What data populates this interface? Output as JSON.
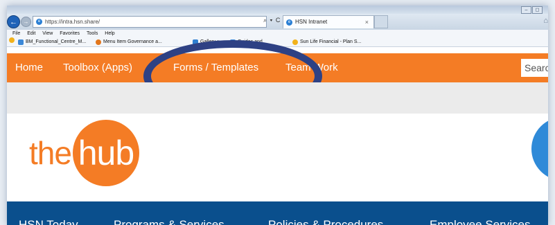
{
  "browser": {
    "window_buttons": [
      "–",
      "◻"
    ],
    "url": "https://intra.hsn.share/",
    "url_tools": "⌕ ▾ C",
    "tab_title": "HSN Intranet",
    "tab_close": "×",
    "menu": [
      "File",
      "Edit",
      "View",
      "Favorites",
      "Tools",
      "Help"
    ],
    "favorites": [
      {
        "label": "BM_Functional_Centre_M...",
        "icon": "ie-page-icon",
        "color": "#3b88d8"
      },
      {
        "label": "Menu Item Governance a...",
        "icon": "gear-icon",
        "color": "#e2761c"
      },
      {
        "label": "Gallery ▾",
        "icon": "web-slice-icon",
        "color": "#2e7fd1"
      },
      {
        "label": "Guides and",
        "icon": "ie-page-icon",
        "color": "#3b88d8"
      },
      {
        "label": "Sun Life Financial - Plan S...",
        "icon": "sun-icon",
        "color": "#f2b21b"
      }
    ]
  },
  "site": {
    "top_nav": [
      "Home",
      "Toolbox (Apps)",
      "Forms / Templates",
      "Team Work"
    ],
    "search_placeholder": "Search",
    "logo": {
      "prefix": "the",
      "circle_text": "hub"
    },
    "bottom_nav": [
      "HSN Today",
      "Programs & Services",
      "Policies & Procedures",
      "Employee Services"
    ]
  },
  "colors": {
    "nav_orange": "#f47c25",
    "highlight_ellipse": "#2e4184",
    "bottom_nav_blue": "#0a4f8d"
  }
}
